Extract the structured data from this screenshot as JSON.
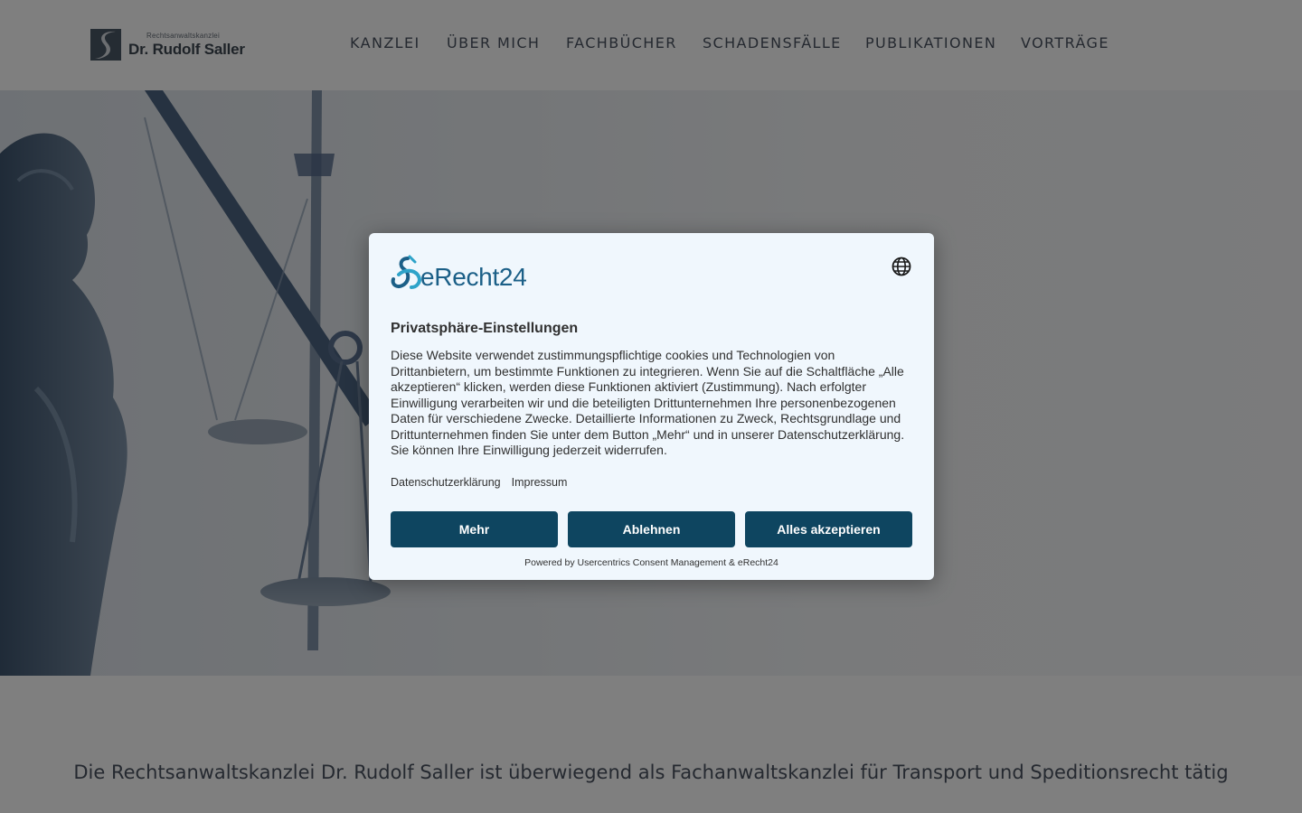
{
  "header": {
    "logo_small": "Rechtsanwaltskanzlei",
    "logo_name": "Dr. Rudolf Saller",
    "nav": [
      "KANZLEI",
      "ÜBER MICH",
      "FACHBÜCHER",
      "SCHADENSFÄLLE",
      "PUBLIKATIONEN",
      "VORTRÄGE"
    ]
  },
  "main": {
    "intro": "Die Rechtsanwaltskanzlei Dr. Rudolf Saller ist überwiegend als Fachanwaltskanzlei für Transport und Speditionsrecht tätig"
  },
  "consent": {
    "brand": "eRecht24",
    "language_icon": "globe-icon",
    "title": "Privatsphäre-Einstellungen",
    "body": "Diese Website verwendet zustimmungspflichtige cookies und Technologien von Drittanbietern, um bestimmte Funktionen zu integrieren. Wenn Sie auf die Schaltfläche „Alle akzeptieren“ klicken, werden diese Funktionen aktiviert (Zustimmung). Nach erfolgter Einwilligung verarbeiten wir und die beteiligten Drittunternehmen Ihre personenbezogenen Daten für verschiedene Zwecke. Detaillierte Informationen zu Zweck, Rechtsgrundlage und Drittunternehmen finden Sie unter dem Button „Mehr“ und in unserer Datenschutzerklärung. Sie können Ihre Einwilligung jederzeit widerrufen.",
    "links": {
      "privacy": "Datenschutzerklärung",
      "imprint": "Impressum"
    },
    "buttons": {
      "more": "Mehr",
      "decline": "Ablehnen",
      "accept_all": "Alles akzeptieren"
    },
    "powered_by": "Powered by Usercentrics Consent Management & eRecht24"
  },
  "colors": {
    "button": "#0e4560",
    "brand": "#1b5f87",
    "dialog_bg": "#f0f7fd",
    "nav_text": "#4a5361"
  }
}
